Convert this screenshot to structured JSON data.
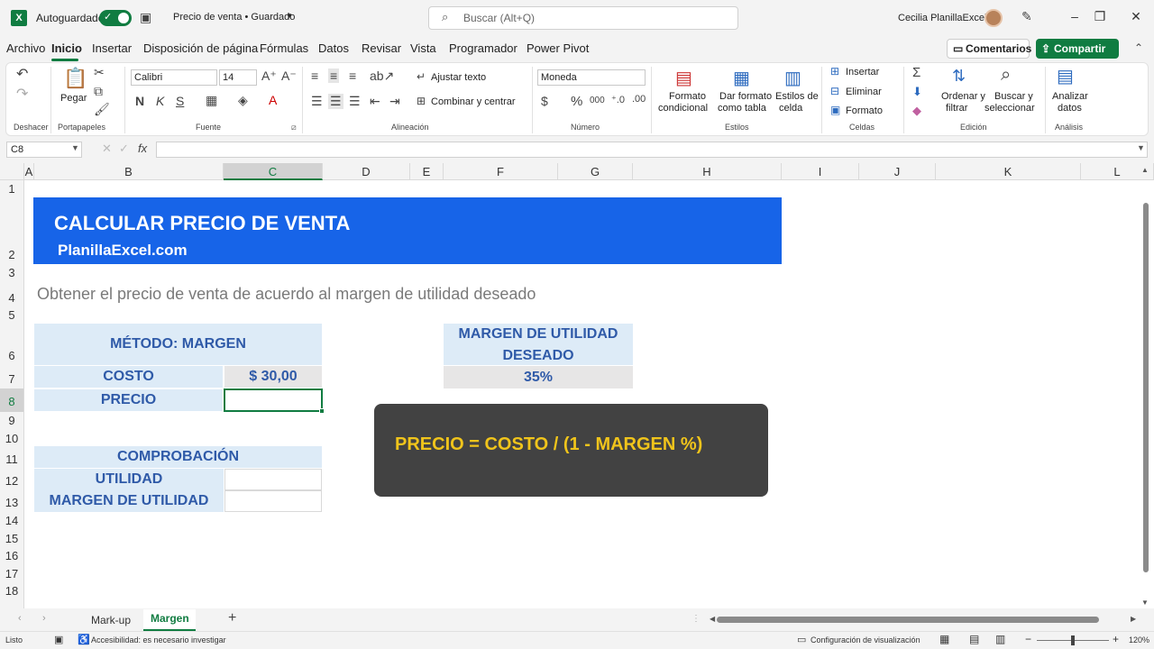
{
  "titlebar": {
    "autosave_label": "Autoguardado",
    "doc_title": "Precio de venta • Guardado",
    "search_placeholder": "Buscar (Alt+Q)",
    "user_name": "Cecilia PlanillaExcel"
  },
  "menu": {
    "tabs": [
      "Archivo",
      "Inicio",
      "Insertar",
      "Disposición de página",
      "Fórmulas",
      "Datos",
      "Revisar",
      "Vista",
      "Programador",
      "Power Pivot"
    ],
    "active_tab": "Inicio",
    "comments_label": "Comentarios",
    "share_label": "Compartir"
  },
  "ribbon": {
    "groups": {
      "undo": "Deshacer",
      "clipboard": "Portapapeles",
      "font": "Fuente",
      "alignment": "Alineación",
      "number": "Número",
      "styles": "Estilos",
      "cells": "Celdas",
      "editing": "Edición",
      "analysis": "Análisis"
    },
    "paste_label": "Pegar",
    "font_name": "Calibri",
    "font_size": "14",
    "wrap_text": "Ajustar texto",
    "merge_center": "Combinar y centrar",
    "number_format": "Moneda",
    "cond_format": [
      "Formato",
      "condicional"
    ],
    "format_table": [
      "Dar formato",
      "como tabla"
    ],
    "cell_styles": [
      "Estilos de",
      "celda"
    ],
    "insert": "Insertar",
    "delete": "Eliminar",
    "format": "Formato",
    "sort_filter": [
      "Ordenar y",
      "filtrar"
    ],
    "find_select": [
      "Buscar y",
      "seleccionar"
    ],
    "analyze": [
      "Analizar",
      "datos"
    ]
  },
  "formula_bar": {
    "name_box": "C8",
    "fx": "fx",
    "content": ""
  },
  "columns": [
    "A",
    "B",
    "C",
    "D",
    "E",
    "F",
    "G",
    "H",
    "I",
    "J",
    "K",
    "L"
  ],
  "rows": [
    "1",
    "2",
    "3",
    "4",
    "5",
    "6",
    "7",
    "8",
    "9",
    "10",
    "11",
    "12",
    "13",
    "14",
    "15",
    "16",
    "17",
    "18"
  ],
  "sheet": {
    "banner_title": "CALCULAR PRECIO DE VENTA",
    "banner_subtitle": "PlanillaExcel.com",
    "description": "Obtener el precio de venta de acuerdo al margen de utilidad deseado",
    "method_header": "MÉTODO: MARGEN",
    "cost_label": "COSTO",
    "cost_value": "$ 30,00",
    "price_label": "PRECIO",
    "price_value": "",
    "margin_header_1": "MARGEN DE UTILIDAD",
    "margin_header_2": "DESEADO",
    "margin_value": "35%",
    "formula": "PRECIO = COSTO / (1 - MARGEN %)",
    "check_header": "COMPROBACIÓN",
    "utility_label": "UTILIDAD",
    "utility_value": "",
    "margin_label": "MARGEN DE UTILIDAD",
    "margin_check_value": ""
  },
  "sheet_tabs": [
    "Mark-up",
    "Margen"
  ],
  "active_sheet": "Margen",
  "statusbar": {
    "ready": "Listo",
    "accessibility": "Accesibilidad: es necesario investigar",
    "display_settings": "Configuración de visualización",
    "zoom": "120%"
  },
  "colors": {
    "excel_green": "#107c41",
    "banner_blue": "#1764e8",
    "label_blue": "#2f5aa8",
    "formula_yellow": "#f0c41b"
  }
}
